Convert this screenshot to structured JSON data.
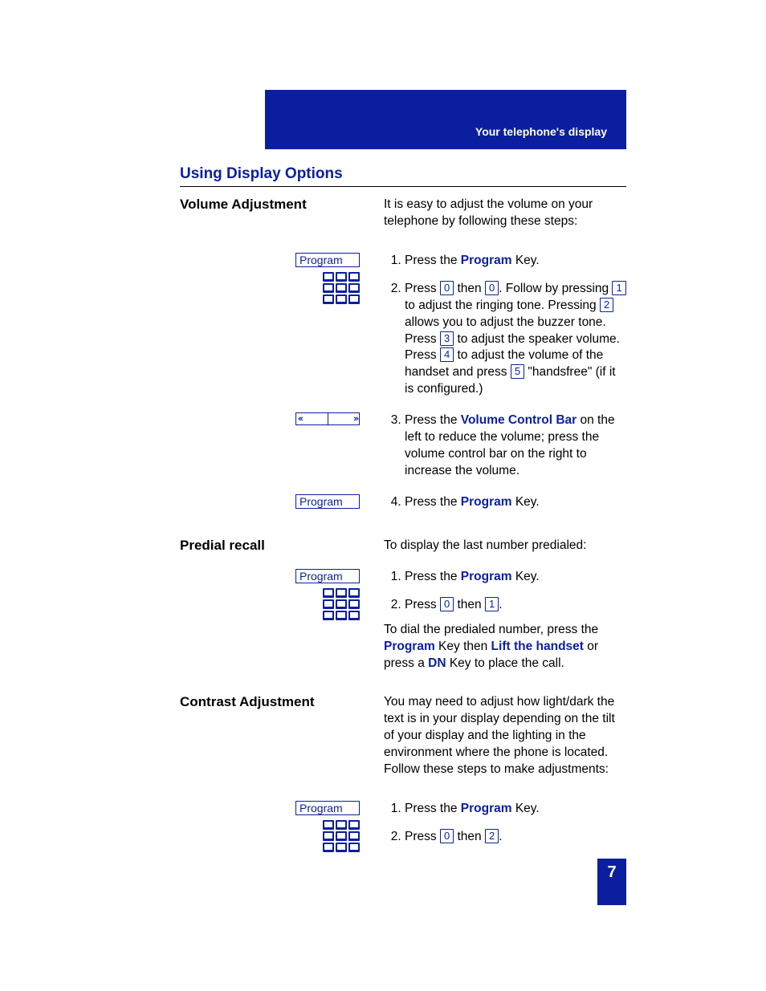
{
  "header": {
    "breadcrumb": "Your telephone's display"
  },
  "section_title": "Using Display Options",
  "program_label": "Program",
  "vol_adj": {
    "heading": "Volume Adjustment",
    "intro": "It is easy to adjust the volume on your telephone by following these steps:",
    "step1_a": "Press the ",
    "step1_b": "Program",
    "step1_c": " Key.",
    "step2_a": "Press ",
    "step2_key1": "0",
    "step2_b": " then ",
    "step2_key2": "0",
    "step2_c": ". Follow by pressing ",
    "step2_key3": "1",
    "step2_d": " to adjust the ringing tone. Pressing ",
    "step2_key4": "2",
    "step2_e": " allows you to adjust the buzzer tone.  Press ",
    "step2_key5": "3",
    "step2_f": " to adjust the speaker volume.  Press ",
    "step2_key6": "4",
    "step2_g": " to adjust the volume of the handset and press ",
    "step2_key7": "5",
    "step2_h": " \"handsfree\" (if it is configured.)",
    "step3_a": "Press the ",
    "step3_b": "Volume Control Bar",
    "step3_c": " on the left to reduce the volume; press the volume control bar on the right to increase the volume.",
    "step4_a": "Press the ",
    "step4_b": "Program",
    "step4_c": " Key."
  },
  "predial": {
    "heading": "Predial recall",
    "intro": "To display the last number predialed:",
    "step1_a": "Press the ",
    "step1_b": "Program",
    "step1_c": " Key.",
    "step2_a": "Press ",
    "step2_key1": "0",
    "step2_b": " then ",
    "step2_key2": "1",
    "step2_c": ".",
    "after_a": "To dial the predialed number, press the ",
    "after_b": "Program",
    "after_c": " Key then ",
    "after_d": "Lift the handset",
    "after_e": " or press a ",
    "after_f": "DN",
    "after_g": " Key to place the call."
  },
  "contrast": {
    "heading": "Contrast Adjustment",
    "intro": "You may need to adjust how light/dark the text is in your display depending on the tilt of your display and the lighting in the environment where the phone is located. Follow these steps to make adjustments:",
    "step1_a": "Press the ",
    "step1_b": "Program",
    "step1_c": " Key.",
    "step2_a": "Press ",
    "step2_key1": "0",
    "step2_b": " then ",
    "step2_key2": "2",
    "step2_c": "."
  },
  "page_number": "7"
}
